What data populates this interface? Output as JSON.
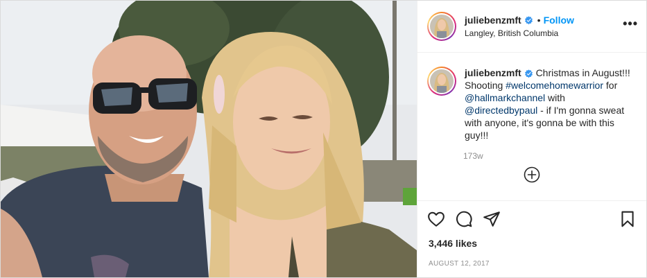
{
  "post": {
    "photo_alt": "photo",
    "header": {
      "username": "juliebenzmft",
      "dot": "•",
      "follow_label": "Follow",
      "location": "Langley, British Columbia",
      "more": "•••"
    },
    "caption": {
      "username": "juliebenzmft",
      "text_1": "Christmas in August!!! Shooting ",
      "hashtag": "#welcomehomewarrior",
      "text_2": " for ",
      "mention_1": "@hallmarkchannel",
      "text_3": " with ",
      "mention_2": "@directedbypaul",
      "text_4": " - if I'm gonna sweat with anyone, it's gonna be with this guy!!!",
      "time_ago": "173w"
    },
    "likes": "3,446 likes",
    "date": "August 12, 2017"
  },
  "colors": {
    "accent": "#0095f6",
    "link": "#00376b",
    "muted": "#8e8e8e",
    "border": "#dbdbdb"
  },
  "icons": {
    "like": "heart-icon",
    "comment": "comment-icon",
    "share": "paper-plane-icon",
    "save": "bookmark-icon",
    "verified": "verified-badge-icon",
    "more": "more-options-icon",
    "load_more": "plus-circle-icon"
  }
}
